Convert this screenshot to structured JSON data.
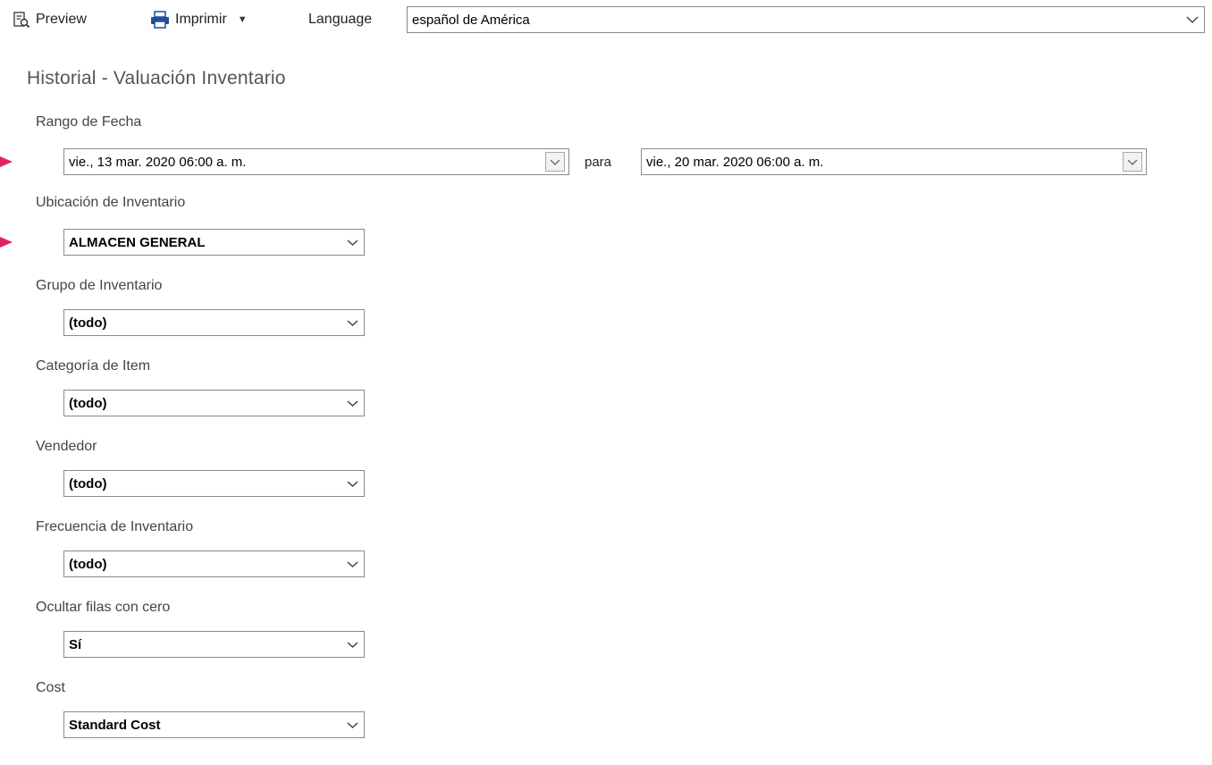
{
  "toolbar": {
    "preview_label": "Preview",
    "print_label": "Imprimir",
    "language_label": "Language",
    "language_value": "español de América"
  },
  "page_title": "Historial - Valuación Inventario",
  "date_range": {
    "label": "Rango de Fecha",
    "from": "vie., 13 mar. 2020 06:00 a. m.",
    "to_label": "para",
    "to": "vie., 20 mar. 2020 06:00 a. m."
  },
  "fields": [
    {
      "label": "Ubicación de Inventario",
      "value": "ALMACEN GENERAL"
    },
    {
      "label": "Grupo de Inventario",
      "value": "(todo)"
    },
    {
      "label": "Categoría de Item",
      "value": "(todo)"
    },
    {
      "label": "Vendedor",
      "value": "(todo)"
    },
    {
      "label": "Frecuencia de Inventario",
      "value": "(todo)"
    },
    {
      "label": "Ocultar filas con cero",
      "value": "Sí"
    },
    {
      "label": "Cost",
      "value": "Standard Cost"
    }
  ],
  "colors": {
    "marker": "#e0245e",
    "print_icon": "#1f4e99"
  }
}
